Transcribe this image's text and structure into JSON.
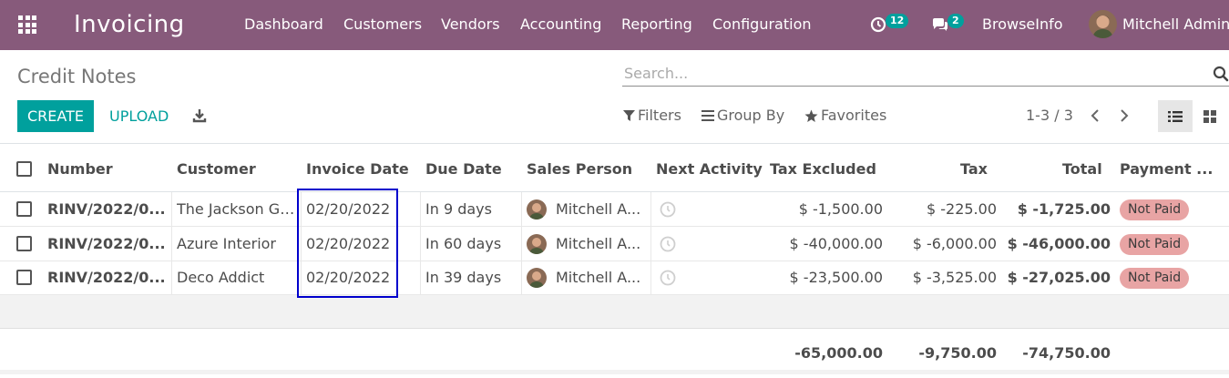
{
  "navbar": {
    "app_name": "Invoicing",
    "menu": [
      "Dashboard",
      "Customers",
      "Vendors",
      "Accounting",
      "Reporting",
      "Configuration"
    ],
    "activity_count": "12",
    "message_count": "2",
    "company": "BrowseInfo",
    "user": "Mitchell Admin"
  },
  "control_panel": {
    "breadcrumb": "Credit Notes",
    "search_placeholder": "Search...",
    "create_label": "CREATE",
    "upload_label": "UPLOAD",
    "filters_label": "Filters",
    "groupby_label": "Group By",
    "favorites_label": "Favorites",
    "pager": "1-3 / 3"
  },
  "table": {
    "columns": [
      "Number",
      "Customer",
      "Invoice Date",
      "Due Date",
      "Sales Person",
      "Next Activity",
      "Tax Excluded",
      "Tax",
      "Total",
      "Payment ..."
    ],
    "rows": [
      {
        "number": "RINV/2022/0...",
        "customer": "The Jackson Gr...",
        "invoice_date": "02/20/2022",
        "due_date": "In 9 days",
        "salesperson": "Mitchell A...",
        "tax_excluded": "$ -1,500.00",
        "tax": "$ -225.00",
        "total": "$ -1,725.00",
        "status": "Not Paid"
      },
      {
        "number": "RINV/2022/0...",
        "customer": "Azure Interior",
        "invoice_date": "02/20/2022",
        "due_date": "In 60 days",
        "salesperson": "Mitchell A...",
        "tax_excluded": "$ -40,000.00",
        "tax": "$ -6,000.00",
        "total": "$ -46,000.00",
        "status": "Not Paid"
      },
      {
        "number": "RINV/2022/0...",
        "customer": "Deco Addict",
        "invoice_date": "02/20/2022",
        "due_date": "In 39 days",
        "salesperson": "Mitchell A...",
        "tax_excluded": "$ -23,500.00",
        "tax": "$ -3,525.00",
        "total": "$ -27,025.00",
        "status": "Not Paid"
      }
    ],
    "totals": {
      "tax_excluded": "-65,000.00",
      "tax": "-9,750.00",
      "total": "-74,750.00"
    }
  },
  "colors": {
    "navbar": "#875a7b",
    "primary": "#00a09d",
    "not_paid_badge": "#e8a4a4",
    "highlight_box": "#0000cc"
  }
}
